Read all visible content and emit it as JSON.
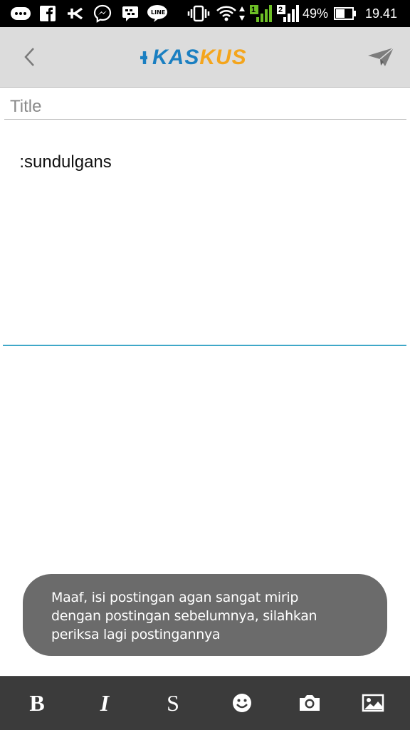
{
  "status_bar": {
    "battery_percent": "49%",
    "time": "19.41",
    "sim1_label": "1",
    "sim2_label": "2",
    "notification_icons": [
      "bbm-icon",
      "facebook-icon",
      "kaskus-icon",
      "messenger-icon",
      "bbm-chat-icon",
      "line-icon"
    ],
    "line_label": "LINE"
  },
  "app_bar": {
    "logo_part1": "KAS",
    "logo_part2": "KUS",
    "logo_colors": {
      "part1": "#1a7fc1",
      "part2": "#f4a51c"
    }
  },
  "editor": {
    "title_placeholder": "Title",
    "title_value": "",
    "body_text": ":sundulgans",
    "accent_color": "#3fa8c8"
  },
  "toast": {
    "message": "Maaf, isi postingan agan sangat mirip dengan postingan sebelumnya, silahkan periksa lagi postingannya"
  },
  "toolbar": {
    "bold_label": "B",
    "italic_label": "I",
    "strike_label": "S"
  }
}
